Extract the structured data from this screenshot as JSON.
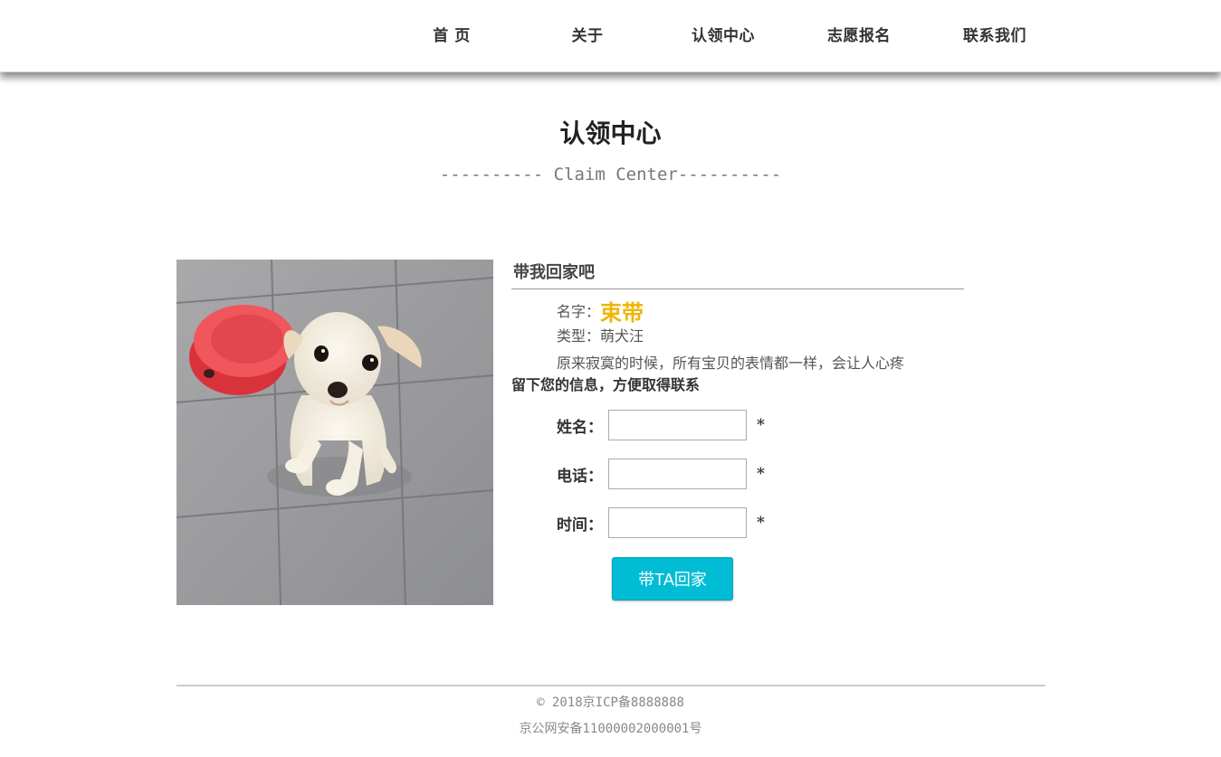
{
  "nav": {
    "items": [
      {
        "label": "首 页"
      },
      {
        "label": "关于"
      },
      {
        "label": "认领中心"
      },
      {
        "label": "志愿报名"
      },
      {
        "label": "联系我们"
      }
    ]
  },
  "section": {
    "title": "认领中心",
    "subtitle": "---------- Claim Center----------"
  },
  "pet": {
    "photo_label": "dog-photo",
    "card_title": "带我回家吧",
    "name_label": "名字：",
    "name_value": "束带",
    "type_text": "类型：萌犬汪",
    "description": "原来寂寞的时候，所有宝贝的表情都一样，会让人心疼"
  },
  "form": {
    "intro": "留下您的信息，方便取得联系",
    "name_label": "姓名：",
    "phone_label": "电话：",
    "time_label": "时间：",
    "name_value": "",
    "phone_value": "",
    "time_value": "",
    "required_mark": "*",
    "submit_label": "带TA回家"
  },
  "footer": {
    "copyright": "© 2018京ICP备8888888",
    "police_record": "京公网安备11000002000001号"
  },
  "colors": {
    "accent_button": "#00bcd4",
    "pet_name": "#f0b400"
  }
}
